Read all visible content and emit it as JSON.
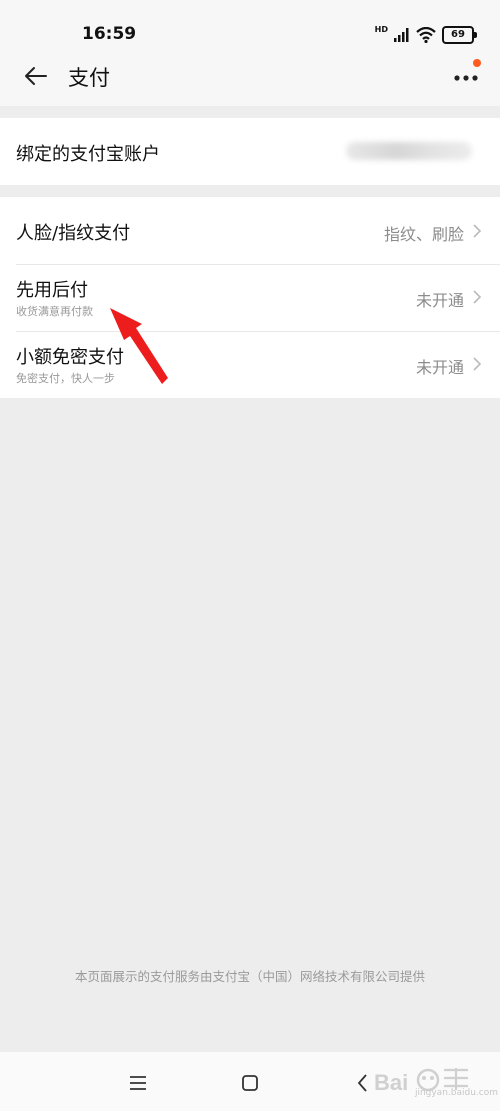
{
  "status_bar": {
    "time": "16:59",
    "battery": "69",
    "network_label": "HD"
  },
  "nav": {
    "title": "支付"
  },
  "account": {
    "label": "绑定的支付宝账户"
  },
  "payment_items": [
    {
      "title": "人脸/指纹支付",
      "subtitle": "",
      "value": "指纹、刷脸"
    },
    {
      "title": "先用后付",
      "subtitle": "收货满意再付款",
      "value": "未开通"
    },
    {
      "title": "小额免密支付",
      "subtitle": "免密支付，快人一步",
      "value": "未开通"
    }
  ],
  "footer_note": "本页面展示的支付服务由支付宝（中国）网络技术有限公司提供",
  "watermark": {
    "text": "jingyan.baidu.com"
  },
  "colors": {
    "accent_dot": "#ff5a1f",
    "annotation_arrow": "#ee1d1d",
    "background": "#ededed"
  }
}
